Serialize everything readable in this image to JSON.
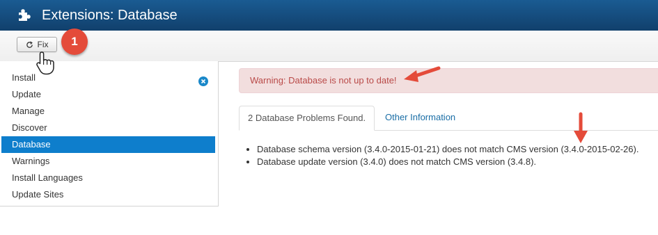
{
  "header": {
    "title": "Extensions: Database",
    "icon": "puzzle-icon"
  },
  "toolbar": {
    "fix_label": "Fix",
    "fix_icon": "refresh-icon",
    "step_badge": "1"
  },
  "sidebar": {
    "items": [
      {
        "label": "Install",
        "active": false
      },
      {
        "label": "Update",
        "active": false
      },
      {
        "label": "Manage",
        "active": false
      },
      {
        "label": "Discover",
        "active": false
      },
      {
        "label": "Database",
        "active": true
      },
      {
        "label": "Warnings",
        "active": false
      },
      {
        "label": "Install Languages",
        "active": false
      },
      {
        "label": "Update Sites",
        "active": false
      }
    ]
  },
  "alert": {
    "text": "Warning: Database is not up to date!"
  },
  "tabs": [
    {
      "label": "2 Database Problems Found.",
      "active": true
    },
    {
      "label": "Other Information",
      "active": false
    }
  ],
  "problems": [
    "Database schema version (3.4.0-2015-01-21) does not match CMS version (3.4.0-2015-02-26).",
    "Database update version (3.4.0) does not match CMS version (3.4.8)."
  ],
  "colors": {
    "header_bg": "#16507f",
    "active_nav": "#0e7ecc",
    "alert_bg": "#f2dede",
    "alert_text": "#b94a48",
    "annotation": "#e44b3a",
    "link": "#1a6ea6"
  }
}
